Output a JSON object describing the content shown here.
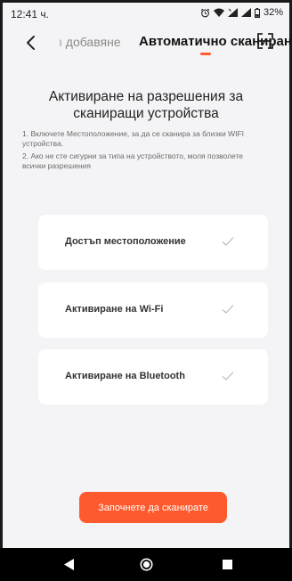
{
  "status_bar": {
    "time": "12:41 ч.",
    "battery": "32%"
  },
  "header": {
    "prev_tab": "ı добавяне",
    "active_tab": "Автоматично сканиран"
  },
  "content": {
    "title": "Активиране на разрешения за сканиращи устройства",
    "instructions": [
      "1. Включете Местоположение, за да се сканира за близки WIFI устройства.",
      "2. Ако не сте сигурни за типа на устройството, моля позволете всички разрешения"
    ]
  },
  "permissions": [
    {
      "label": "Достъп местоположение"
    },
    {
      "label": "Активиране на Wi-Fi"
    },
    {
      "label": "Активиране на Bluetooth"
    }
  ],
  "start_button": {
    "label": "Започнете да сканирате"
  },
  "colors": {
    "accent": "#ff5a2d",
    "background": "#f4f4f6",
    "card": "#ffffff"
  },
  "icons": {
    "back": "chevron-left-icon",
    "scan": "scan-frame-icon",
    "check": "check-icon"
  }
}
